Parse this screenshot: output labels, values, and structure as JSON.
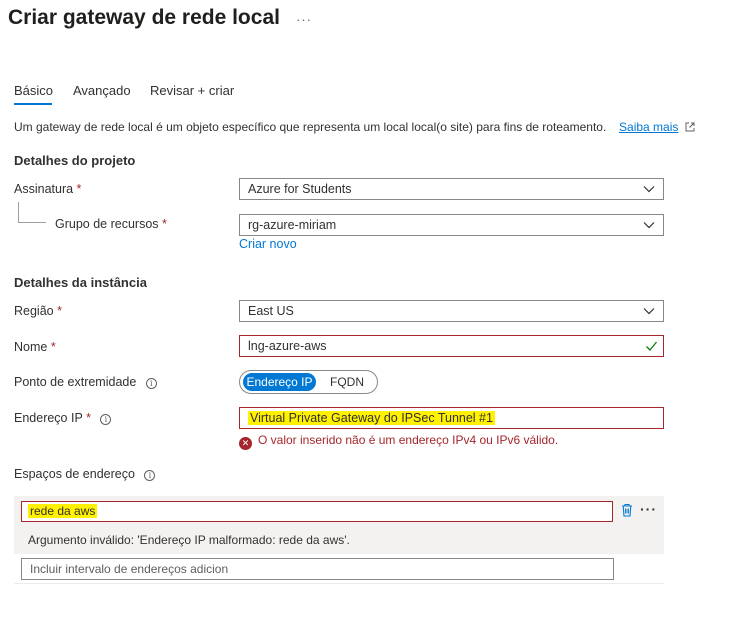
{
  "page": {
    "title": "Criar gateway de rede local",
    "more": "···"
  },
  "tabs": [
    {
      "label": "Básico",
      "active": true
    },
    {
      "label": "Avançado",
      "active": false
    },
    {
      "label": "Revisar + criar",
      "active": false
    }
  ],
  "description": {
    "text": "Um gateway de rede local é um objeto específico que representa um local local(o site) para fins de roteamento.",
    "link": "Saiba mais"
  },
  "project": {
    "heading": "Detalhes do projeto",
    "subscription_label": "Assinatura",
    "subscription_value": "Azure for Students",
    "resource_group_label": "Grupo de recursos",
    "resource_group_value": "rg-azure-miriam",
    "create_new": "Criar novo"
  },
  "instance": {
    "heading": "Detalhes da instância",
    "region_label": "Região",
    "region_value": "East US",
    "name_label": "Nome",
    "name_value": "lng-azure-aws",
    "endpoint_label": "Ponto de extremidade",
    "endpoint_options": [
      "Endereço IP",
      "FQDN"
    ],
    "ip_label": "Endereço IP",
    "ip_value": "Virtual Private Gateway do IPSec Tunnel #1",
    "ip_error": "O valor inserido não é um endereço IPv4 ou IPv6 válido."
  },
  "address_spaces": {
    "label": "Espaços de endereço",
    "value": "rede da aws",
    "error": "Argumento inválido: 'Endereço IP malformado: rede da aws'.",
    "add_placeholder": "Incluir intervalo de endereços adicion",
    "more": "···"
  },
  "required_mark": "*",
  "colors": {
    "accent": "#0078d4",
    "error": "#a4262c",
    "highlight": "#fff100",
    "valid": "#107c10"
  }
}
